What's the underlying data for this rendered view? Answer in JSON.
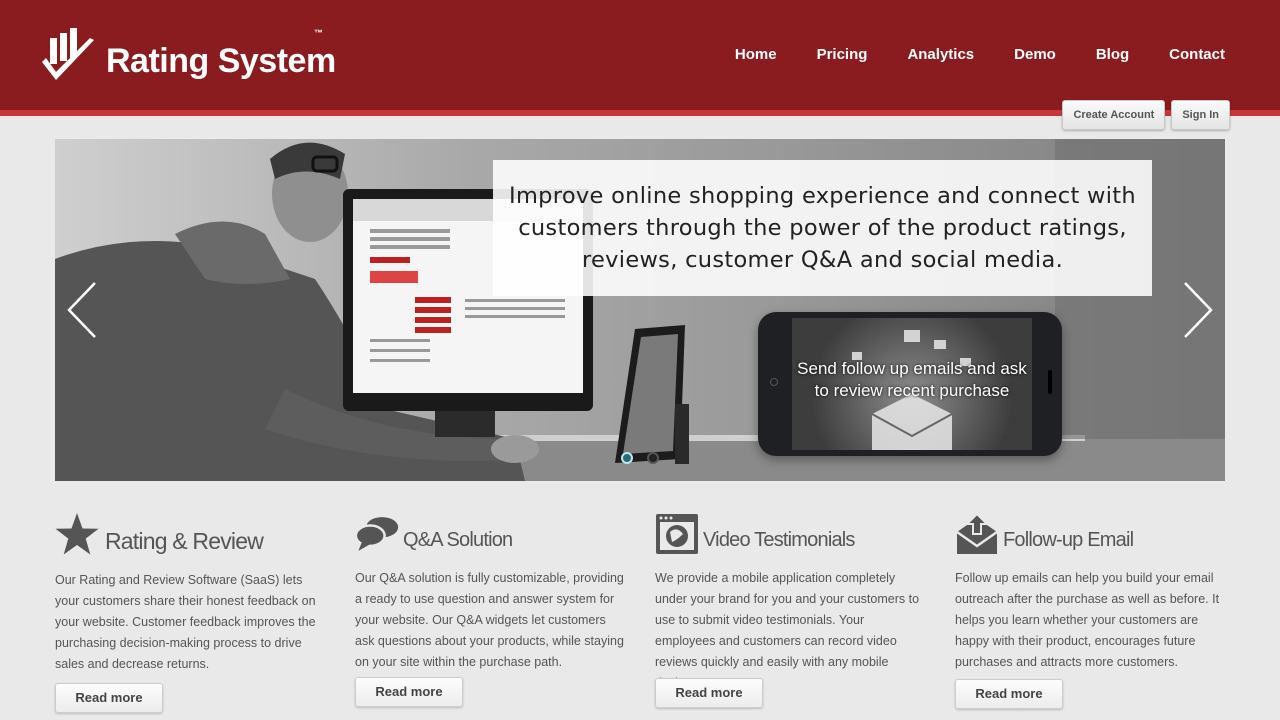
{
  "brand": {
    "name": "Rating System",
    "tm": "™",
    "logo_icon": "checkmark-bars-logo"
  },
  "nav": {
    "items": [
      "Home",
      "Pricing",
      "Analytics",
      "Demo",
      "Blog",
      "Contact"
    ]
  },
  "account": {
    "create_label": "Create Account",
    "signin_label": "Sign In"
  },
  "slider": {
    "caption": "Improve online shopping experience and connect with customers through the power of the product ratings, reviews, customer Q&A and social media.",
    "phone_text": "Send follow up emails and ask to review recent purchase",
    "prev_icon": "chevron-left-icon",
    "next_icon": "chevron-right-icon",
    "active_slide": 1,
    "slide_count": 2
  },
  "features": [
    {
      "title": "Rating & Review",
      "icon": "star-icon",
      "body": "Our Rating and Review Software (SaaS) lets your customers share their honest feedback on your website. Customer feedback improves the purchasing decision-making process to drive sales and decrease returns.",
      "button": "Read more"
    },
    {
      "title": "Q&A Solution",
      "icon": "chat-bubbles-icon",
      "body": "Our Q&A solution is fully customizable, providing a ready to use question and answer system for your website. Our Q&A widgets let customers ask questions about your products, while staying on your site within the purchase path.",
      "button": "Read more"
    },
    {
      "title": "Video Testimonials",
      "icon": "video-window-icon",
      "body": "We provide a mobile application completely under your brand for you and your customers to use to submit video testimonials. Your employees and customers can record video reviews quickly and easily with any mobile device.",
      "button": "Read more"
    },
    {
      "title": "Follow-up Email",
      "icon": "envelope-upload-icon",
      "body": "Follow up emails can help you build your email outreach after the purchase as well as before. It helps you learn whether your customers are happy with their product, encourages future purchases and attracts more customers.",
      "button": "Read more"
    }
  ],
  "colors": {
    "header_bg": "#8a1c1f",
    "header_stripe": "#c8373b",
    "page_bg": "#e9e9e9"
  }
}
